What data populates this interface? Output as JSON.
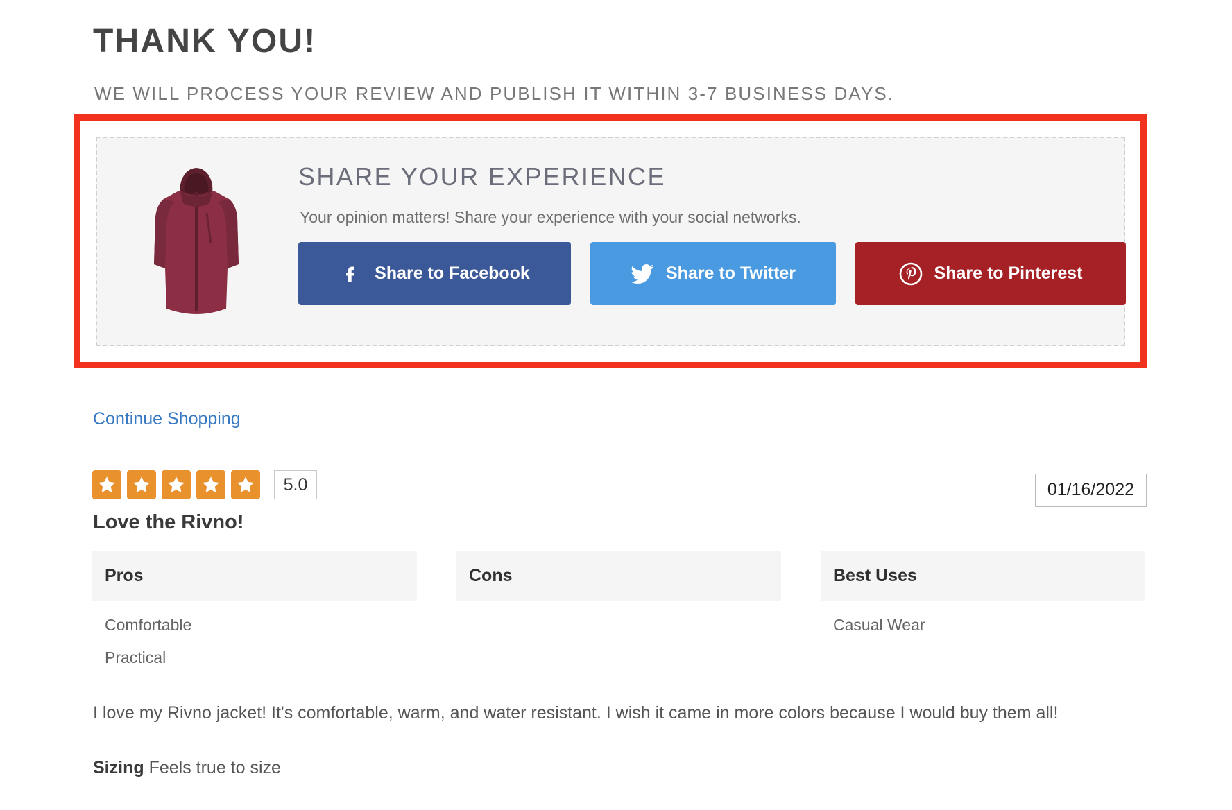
{
  "header": {
    "title": "THANK YOU!",
    "subtitle": "WE WILL PROCESS YOUR REVIEW AND PUBLISH IT WITHIN 3-7 BUSINESS DAYS."
  },
  "share_panel": {
    "highlight_color": "#f0321e",
    "title": "SHARE YOUR EXPERIENCE",
    "subtitle": "Your opinion matters! Share your experience with your social networks.",
    "product_image_alt": "maroon hooded jacket",
    "buttons": [
      {
        "label": "Share to Facebook",
        "icon": "facebook-icon",
        "color": "#3b5998"
      },
      {
        "label": "Share to Twitter",
        "icon": "twitter-icon",
        "color": "#4a9ae1"
      },
      {
        "label": "Share to Pinterest",
        "icon": "pinterest-icon",
        "color": "#a52126"
      }
    ]
  },
  "continue_shopping": {
    "label": "Continue Shopping",
    "color": "#3778c2"
  },
  "review": {
    "rating": {
      "stars_filled": 5,
      "score": "5.0",
      "star_color": "#e8912d"
    },
    "date": "01/16/2022",
    "title": "Love the Rivno!",
    "columns": [
      {
        "heading": "Pros",
        "items": [
          "Comfortable",
          "Practical"
        ]
      },
      {
        "heading": "Cons",
        "items": []
      },
      {
        "heading": "Best Uses",
        "items": [
          "Casual Wear"
        ]
      }
    ],
    "body": "I love my Rivno jacket! It's comfortable, warm, and water resistant. I wish it came in more colors because I would buy them all!",
    "sizing_label": "Sizing",
    "sizing_value": "Feels true to size"
  }
}
